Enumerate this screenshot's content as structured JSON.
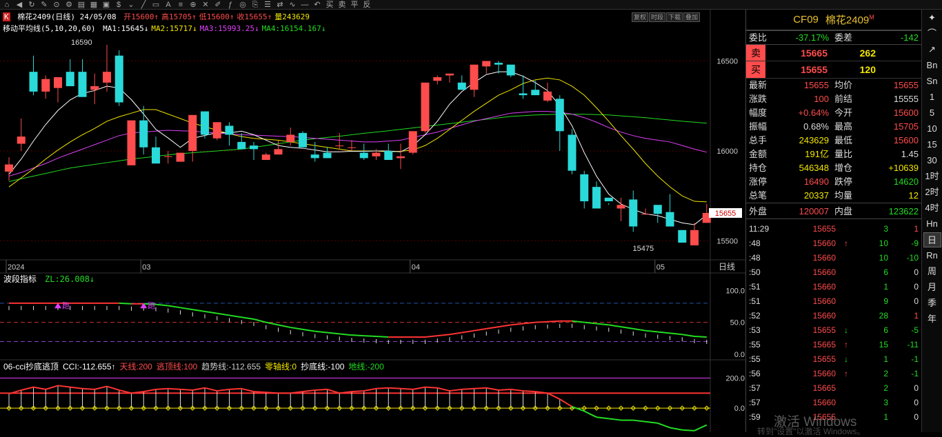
{
  "toolbar": {
    "icons": [
      "home-icon",
      "back-icon",
      "refresh-icon",
      "pencil-icon",
      "pin-icon",
      "gear-icon",
      "lock-icon",
      "grid-icon",
      "doc-icon",
      "dollar-icon",
      "chevron-icon",
      "line-icon",
      "rect-icon",
      "text-icon",
      "bars-icon",
      "zoom-icon",
      "x-icon",
      "draw-icon",
      "fx-icon",
      "target-icon",
      "clip-icon",
      "menu-icon",
      "cmp-icon",
      "wave-icon",
      "min-icon",
      "back2-icon"
    ],
    "labels": [
      "买",
      "卖",
      "平",
      "反"
    ]
  },
  "header": {
    "logo": "K",
    "title": "棉花2409(日线) 24/05/08",
    "items": [
      {
        "text": "开15600↑",
        "color": "#ff4c4c"
      },
      {
        "text": "高15705↑",
        "color": "#ff4c4c"
      },
      {
        "text": "低15600↑",
        "color": "#ff4c4c"
      },
      {
        "text": "收15655↑",
        "color": "#ff4c4c"
      },
      {
        "text": "量243629",
        "color": "#f2e600"
      }
    ],
    "ma_label": "移动平均线(5,10,20,60)",
    "ma": [
      {
        "text": "MA1:15645↓",
        "color": "#ffffff"
      },
      {
        "text": "MA2:15717↓",
        "color": "#f2e600"
      },
      {
        "text": "MA3:15993.25↓",
        "color": "#e040fb"
      },
      {
        "text": "MA4:16154.167↓",
        "color": "#22dd22"
      }
    ],
    "tabs": [
      "复权",
      "时段",
      "下载",
      "叠加"
    ]
  },
  "chart_data": [
    {
      "type": "candlestick",
      "title": "棉花2409(日线)",
      "y_ticks": [
        15500,
        16000,
        16500
      ],
      "ylim": [
        15425,
        16640
      ],
      "x_labels": [
        "2024",
        "03",
        "04",
        "05"
      ],
      "x_label_index": [
        0,
        11,
        33,
        53
      ],
      "axis_tag": "日线",
      "last_price": "15655",
      "annotations": [
        {
          "text": "16590",
          "index": 8,
          "value": 16590
        },
        {
          "text": "15475",
          "index": 54,
          "value": 15475
        }
      ],
      "ohlc": [
        [
          15885,
          15965,
          15835,
          15925
        ],
        [
          16040,
          16180,
          16000,
          16080
        ],
        [
          16440,
          16530,
          16310,
          16330
        ],
        [
          16330,
          16420,
          16290,
          16400
        ],
        [
          16350,
          16400,
          16270,
          16410
        ],
        [
          16440,
          16510,
          16360,
          16360
        ],
        [
          16440,
          16510,
          16300,
          16300
        ],
        [
          16340,
          16430,
          16260,
          16360
        ],
        [
          16380,
          16590,
          16330,
          16440
        ],
        [
          16530,
          16560,
          16250,
          16270
        ],
        [
          15920,
          16140,
          15920,
          16170
        ],
        [
          16170,
          16250,
          15980,
          16020
        ],
        [
          16020,
          16080,
          15970,
          15930
        ],
        [
          15970,
          16000,
          15930,
          15970
        ],
        [
          15940,
          15990,
          15940,
          15990
        ],
        [
          16000,
          16040,
          15940,
          16200
        ],
        [
          16220,
          16220,
          16070,
          16090
        ],
        [
          16070,
          16160,
          16060,
          16160
        ],
        [
          16140,
          16160,
          16030,
          16090
        ],
        [
          16050,
          16100,
          16010,
          16010
        ],
        [
          16030,
          16050,
          15950,
          16010
        ],
        [
          15950,
          15990,
          15970,
          15980
        ],
        [
          15980,
          16060,
          15980,
          16010
        ],
        [
          16050,
          16130,
          16030,
          16090
        ],
        [
          16100,
          16110,
          16020,
          16020
        ],
        [
          15980,
          16050,
          15940,
          15960
        ],
        [
          15990,
          16020,
          15990,
          15960
        ],
        [
          16030,
          16100,
          16010,
          16030
        ],
        [
          16020,
          16060,
          16000,
          16020
        ],
        [
          15990,
          16040,
          15950,
          15960
        ],
        [
          15970,
          16010,
          15950,
          15990
        ],
        [
          16000,
          16040,
          15960,
          15950
        ],
        [
          15960,
          16040,
          15900,
          15970
        ],
        [
          15990,
          16100,
          15980,
          16110
        ],
        [
          16110,
          16340,
          16100,
          16380
        ],
        [
          16390,
          16420,
          16370,
          16410
        ],
        [
          16420,
          16430,
          16380,
          16430
        ],
        [
          16380,
          16420,
          16340,
          16340
        ],
        [
          16340,
          16440,
          16300,
          16480
        ],
        [
          16470,
          16490,
          16430,
          16500
        ],
        [
          16490,
          16500,
          16430,
          16480
        ],
        [
          16480,
          16410,
          16430,
          16420
        ],
        [
          16320,
          16420,
          16290,
          16310
        ],
        [
          16340,
          16390,
          16310,
          16310
        ],
        [
          16280,
          16380,
          16270,
          16330
        ],
        [
          16290,
          16310,
          16000,
          16110
        ],
        [
          16090,
          16120,
          15870,
          15890
        ],
        [
          15870,
          15890,
          15680,
          15720
        ],
        [
          15800,
          15830,
          15680,
          15680
        ],
        [
          15740,
          15710,
          15700,
          15720
        ],
        [
          15680,
          15740,
          15610,
          15700
        ],
        [
          15730,
          15780,
          15550,
          15580
        ],
        [
          15650,
          15650,
          15680,
          15650
        ],
        [
          15700,
          15650,
          15600,
          15650
        ],
        [
          15660,
          15760,
          15590,
          15580
        ],
        [
          15560,
          15560,
          15525,
          15490
        ],
        [
          15475,
          15600,
          15475,
          15560
        ],
        [
          15600,
          15705,
          15600,
          15655
        ]
      ],
      "ma5": [
        15870,
        15955,
        16055,
        16147,
        16225,
        16284,
        16320,
        16336,
        16360,
        16350,
        16285,
        16205,
        16120,
        16072,
        16020,
        16070,
        16086,
        16102,
        16100,
        16110,
        16090,
        16060,
        16030,
        16020,
        16015,
        16005,
        15995,
        15995,
        15998,
        15998,
        16000,
        16000,
        15995,
        16030,
        16090,
        16165,
        16260,
        16330,
        16380,
        16425,
        16440,
        16440,
        16415,
        16380,
        16335,
        16250,
        16140,
        15990,
        15860,
        15760,
        15705,
        15675,
        15650,
        15640,
        15620,
        15600,
        15590,
        15645
      ],
      "ma10": [
        15800,
        15850,
        15900,
        15955,
        16005,
        16050,
        16090,
        16125,
        16165,
        16190,
        16210,
        16230,
        16230,
        16205,
        16180,
        16155,
        16135,
        16115,
        16095,
        16080,
        16070,
        16065,
        16060,
        16050,
        16040,
        16030,
        16020,
        16010,
        16000,
        16000,
        16000,
        15995,
        15998,
        16005,
        16030,
        16070,
        16120,
        16170,
        16220,
        16265,
        16310,
        16340,
        16375,
        16395,
        16405,
        16395,
        16360,
        16310,
        16240,
        16165,
        16085,
        16010,
        15930,
        15860,
        15800,
        15750,
        15720,
        15717
      ],
      "ma20": [
        15860,
        15880,
        15905,
        15930,
        15960,
        15985,
        16010,
        16035,
        16060,
        16085,
        16100,
        16105,
        16110,
        16115,
        16112,
        16110,
        16105,
        16100,
        16095,
        16090,
        16088,
        16085,
        16082,
        16080,
        16075,
        16070,
        16065,
        16060,
        16055,
        16050,
        16050,
        16055,
        16060,
        16075,
        16090,
        16105,
        16125,
        16145,
        16165,
        16180,
        16195,
        16210,
        16215,
        16220,
        16220,
        16215,
        16205,
        16185,
        16160,
        16130,
        16105,
        16085,
        16070,
        16060,
        16050,
        16030,
        16010,
        15993
      ],
      "ma60": [
        15830,
        15845,
        15860,
        15875,
        15890,
        15905,
        15915,
        15925,
        15935,
        15945,
        15955,
        15962,
        15970,
        15978,
        15985,
        15990,
        15995,
        16000,
        16005,
        16010,
        16020,
        16030,
        16040,
        16050,
        16060,
        16068,
        16075,
        16082,
        16090,
        16098,
        16105,
        16112,
        16120,
        16128,
        16136,
        16144,
        16152,
        16160,
        16168,
        16176,
        16184,
        16192,
        16196,
        16200,
        16202,
        16204,
        16204,
        16204,
        16202,
        16200,
        16195,
        16190,
        16185,
        16178,
        16172,
        16165,
        16160,
        16154
      ]
    },
    {
      "type": "line",
      "title": "波段指标",
      "value_label": "ZL:26.008↓",
      "y_ticks": [
        0.0,
        50.0,
        100.0
      ],
      "ylim": [
        0,
        110
      ],
      "markers": [
        {
          "text": "跑",
          "index": 4
        },
        {
          "text": "跑",
          "index": 11
        }
      ],
      "zl": [
        80,
        80,
        80,
        80,
        80,
        80,
        80,
        80,
        80,
        80,
        79,
        79,
        78,
        76,
        73,
        70,
        67,
        64,
        61,
        58,
        55,
        50,
        46,
        42,
        39,
        36,
        34,
        32,
        30,
        29,
        28,
        27,
        27,
        27,
        27,
        29,
        31,
        34,
        37,
        40,
        43,
        46,
        48,
        50,
        51,
        52,
        52,
        50,
        48,
        46,
        43,
        40,
        37,
        35,
        33,
        31,
        28,
        27
      ]
    },
    {
      "type": "line",
      "title": "06-cci抄底逃顶",
      "params": [
        {
          "text": "CCI:-112.655↑",
          "color": "#ffffff"
        },
        {
          "text": "天线:200",
          "color": "#ff4c4c"
        },
        {
          "text": "逃顶线:100",
          "color": "#ff4c4c"
        },
        {
          "text": "趋势线:-112.655",
          "color": "#cccccc"
        },
        {
          "text": "零轴线:0",
          "color": "#f2e600"
        },
        {
          "text": "抄底线:-100",
          "color": "#ffffff"
        },
        {
          "text": "地线:-200",
          "color": "#22dd22"
        }
      ],
      "y_ticks": [
        0.0,
        200.0
      ],
      "ylim": [
        -160,
        230
      ],
      "cci": [
        95,
        120,
        140,
        125,
        150,
        140,
        130,
        125,
        145,
        120,
        100,
        110,
        125,
        130,
        125,
        120,
        135,
        115,
        125,
        130,
        110,
        105,
        100,
        100,
        110,
        120,
        125,
        100,
        110,
        115,
        130,
        135,
        130,
        125,
        140,
        135,
        115,
        125,
        130,
        135,
        120,
        125,
        115,
        110,
        100,
        60,
        10,
        -20,
        -60,
        -70,
        -80,
        -80,
        -90,
        -100,
        -130,
        -145,
        -150,
        -112
      ]
    }
  ],
  "right_panel": {
    "code": "CF09",
    "name": "棉花2409",
    "badge": "M",
    "weibi": {
      "label": "委比",
      "value": "-37.17%",
      "label2": "委差",
      "value2": "-142"
    },
    "sell": {
      "label": "卖",
      "price": "15665",
      "qty": "262"
    },
    "buy": {
      "label": "买",
      "price": "15655",
      "qty": "120"
    },
    "stats": [
      {
        "l": "最新",
        "v": "15655",
        "vc": "#ff4c4c",
        "l2": "均价",
        "v2": "15655",
        "v2c": "#ff4c4c"
      },
      {
        "l": "涨跌",
        "v": "100",
        "vc": "#ff4c4c",
        "l2": "前结",
        "v2": "15555",
        "v2c": "#dddddd"
      },
      {
        "l": "幅度",
        "v": "+0.64%",
        "vc": "#ff4c4c",
        "l2": "今开",
        "v2": "15600",
        "v2c": "#ff4c4c"
      },
      {
        "l": "振幅",
        "v": "0.68%",
        "vc": "#dddddd",
        "l2": "最高",
        "v2": "15705",
        "v2c": "#ff4c4c"
      },
      {
        "l": "总手",
        "v": "243629",
        "vc": "#f2e600",
        "l2": "最低",
        "v2": "15600",
        "v2c": "#ff4c4c"
      },
      {
        "l": "金额",
        "v": "191亿",
        "vc": "#f2e600",
        "l2": "量比",
        "v2": "1.45",
        "v2c": "#dddddd"
      },
      {
        "l": "持仓",
        "v": "546348",
        "vc": "#f2e600",
        "l2": "增仓",
        "v2": "+10639",
        "v2c": "#f2e600"
      },
      {
        "l": "涨停",
        "v": "16490",
        "vc": "#ff4c4c",
        "l2": "跌停",
        "v2": "14620",
        "v2c": "#22dd22"
      },
      {
        "l": "总笔",
        "v": "20337",
        "vc": "#f2e600",
        "l2": "均量",
        "v2": "12",
        "v2c": "#f2e600"
      }
    ],
    "waipan": {
      "l": "外盘",
      "v": "120007",
      "l2": "内盘",
      "v2": "123622"
    },
    "ticks": [
      {
        "t": "11:29",
        "p": "15655",
        "pc": "#ff4c4c",
        "a": "",
        "ac": "",
        "vol": "3",
        "vd": "1",
        "vdc": "#ff4c4c"
      },
      {
        "t": ":48",
        "p": "15660",
        "pc": "#ff4c4c",
        "a": "↑",
        "ac": "#ff4c4c",
        "vol": "10",
        "vd": "-9",
        "vdc": "#22dd22"
      },
      {
        "t": ":48",
        "p": "15660",
        "pc": "#ff4c4c",
        "a": "",
        "ac": "",
        "vol": "10",
        "vd": "-10",
        "vdc": "#22dd22"
      },
      {
        "t": ":50",
        "p": "15660",
        "pc": "#ff4c4c",
        "a": "",
        "ac": "",
        "vol": "6",
        "vd": "0",
        "vdc": "#dddddd"
      },
      {
        "t": ":51",
        "p": "15660",
        "pc": "#ff4c4c",
        "a": "",
        "ac": "",
        "vol": "1",
        "vd": "0",
        "vdc": "#dddddd"
      },
      {
        "t": ":51",
        "p": "15660",
        "pc": "#ff4c4c",
        "a": "",
        "ac": "",
        "vol": "9",
        "vd": "0",
        "vdc": "#dddddd"
      },
      {
        "t": ":52",
        "p": "15660",
        "pc": "#ff4c4c",
        "a": "",
        "ac": "",
        "vol": "28",
        "vd": "1",
        "vdc": "#ff4c4c"
      },
      {
        "t": ":53",
        "p": "15655",
        "pc": "#ff4c4c",
        "a": "↓",
        "ac": "#22dd22",
        "vol": "6",
        "vd": "-5",
        "vdc": "#22dd22"
      },
      {
        "t": ":55",
        "p": "15665",
        "pc": "#ff4c4c",
        "a": "↑",
        "ac": "#ff4c4c",
        "vol": "15",
        "vd": "-11",
        "vdc": "#22dd22"
      },
      {
        "t": ":55",
        "p": "15655",
        "pc": "#ff4c4c",
        "a": "↓",
        "ac": "#22dd22",
        "vol": "1",
        "vd": "-1",
        "vdc": "#22dd22"
      },
      {
        "t": ":56",
        "p": "15660",
        "pc": "#ff4c4c",
        "a": "↑",
        "ac": "#ff4c4c",
        "vol": "2",
        "vd": "-1",
        "vdc": "#22dd22"
      },
      {
        "t": ":57",
        "p": "15665",
        "pc": "#ff4c4c",
        "a": "",
        "ac": "",
        "vol": "2",
        "vd": "0",
        "vdc": "#dddddd"
      },
      {
        "t": ":57",
        "p": "15660",
        "pc": "#ff4c4c",
        "a": "",
        "ac": "",
        "vol": "3",
        "vd": "0",
        "vdc": "#dddddd"
      },
      {
        "t": ":59",
        "p": "15655",
        "pc": "#ff4c4c",
        "a": "",
        "ac": "",
        "vol": "1",
        "vd": "0",
        "vdc": "#dddddd"
      }
    ]
  },
  "sidebar": [
    "Bn",
    "Sn",
    "1",
    "5",
    "10",
    "15",
    "30",
    "1时",
    "2时",
    "4时",
    "Hn",
    "日",
    "Rn",
    "周",
    "月",
    "季",
    "年"
  ],
  "sidebar_active": "日",
  "watermark": {
    "line1": "激活 Windows",
    "line2": "转到\"设置\"以激活 Windows。"
  }
}
